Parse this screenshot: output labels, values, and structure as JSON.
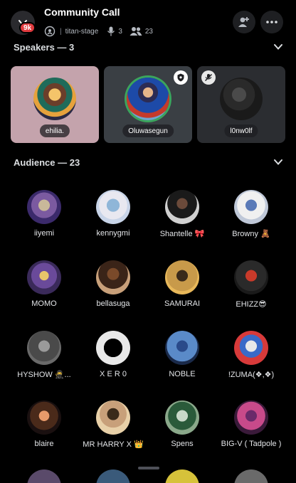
{
  "header": {
    "server_badge": "9k",
    "title": "Community Call",
    "channel": "titan-stage",
    "separator": "|",
    "speaker_count": "3",
    "listener_count": "23"
  },
  "speakers_section": {
    "label": "Speakers — 3"
  },
  "speakers": [
    {
      "name": "ehilia.",
      "card_color": "#c4a3ac"
    },
    {
      "name": "Oluwasegun",
      "card_color": "#3a3f44"
    },
    {
      "name": "l0nw0lf",
      "card_color": "#2b2d31"
    }
  ],
  "audience_section": {
    "label": "Audience — 23"
  },
  "audience": [
    {
      "name": "iiyemi"
    },
    {
      "name": "kennygmi"
    },
    {
      "name": "Shantelle 🎀"
    },
    {
      "name": "Browny 🧸"
    },
    {
      "name": "MOMO"
    },
    {
      "name": "bellasuga"
    },
    {
      "name": "SAMURAI"
    },
    {
      "name": "EHIZZ😎"
    },
    {
      "name": "HYSHOW 🥷..."
    },
    {
      "name": "X E R 0"
    },
    {
      "name": "NOBLE"
    },
    {
      "name": "!ZUMA(❖,❖)"
    },
    {
      "name": "blaire"
    },
    {
      "name": "MR HARRY X 👑"
    },
    {
      "name": "Spens"
    },
    {
      "name": "BIG-V ( Tadpole )"
    }
  ],
  "colors": {
    "background": "#000000",
    "speaking_ring": "#3ba55d",
    "badge_red": "#e03a3e"
  },
  "icons": {
    "server": "chevron-down-icon",
    "stage": "stage-icon",
    "mic": "microphone-icon",
    "listeners": "people-icon",
    "invite": "add-user-icon",
    "more": "more-icon",
    "moderator": "moderator-badge-icon",
    "muted": "mic-off-icon"
  }
}
